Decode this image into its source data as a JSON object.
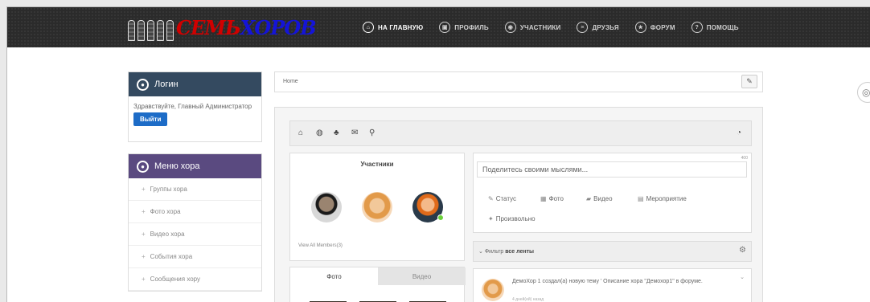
{
  "logo": {
    "part1": "СЕМЬ",
    "part2": "ХОРОВ"
  },
  "nav": [
    {
      "label": "НА ГЛАВНУЮ",
      "icon": "home-icon"
    },
    {
      "label": "ПРОФИЛЬ",
      "icon": "profile-icon"
    },
    {
      "label": "УЧАСТНИКИ",
      "icon": "members-icon"
    },
    {
      "label": "ДРУЗЬЯ",
      "icon": "friends-icon"
    },
    {
      "label": "ФОРУМ",
      "icon": "star-icon"
    },
    {
      "label": "ПОМОЩЬ",
      "icon": "help-icon"
    }
  ],
  "login": {
    "title": "Логин",
    "greeting": "Здравствуйте, Главный Администратор",
    "logout": "Выйти"
  },
  "menu": {
    "title": "Меню хора",
    "items": [
      "Группы хора",
      "Фото хора",
      "Видео хора",
      "События хора",
      "Сообщения хору"
    ]
  },
  "breadcrumb": {
    "home": "Home"
  },
  "members": {
    "title": "Участники",
    "view_all": "View All Members(3)"
  },
  "tabs": {
    "photo": "Фото",
    "video": "Видео"
  },
  "share": {
    "count": "400",
    "placeholder": "Поделитесь своими мыслями...",
    "options": [
      "Статус",
      "Фото",
      "Видео",
      "Мероприятие",
      "Произвольно"
    ]
  },
  "filter": {
    "prefix": "Фильтр",
    "value": "все ленты"
  },
  "feed": {
    "text": "ДемоХор 1 создал(а) новую тему ' Описание хора \"Демохор1\" в форуме.",
    "time": "4 дней(ей) назад"
  },
  "colors": {
    "login_head": "#344a60",
    "menu_head": "#5a4a80",
    "button": "#1d6cc7"
  }
}
